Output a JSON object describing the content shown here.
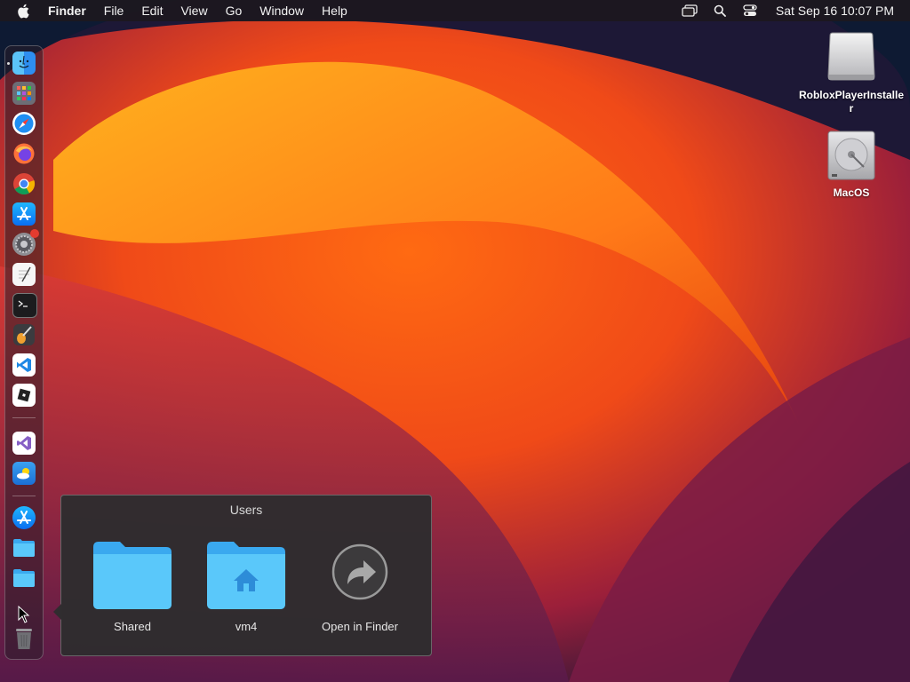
{
  "menubar": {
    "app_name": "Finder",
    "menus": [
      "File",
      "Edit",
      "View",
      "Go",
      "Window",
      "Help"
    ],
    "clock": "Sat Sep 16  10:07 PM"
  },
  "desktop": {
    "icons": [
      {
        "label": "RobloxPlayerInstaller",
        "icon": "disk-image-icon"
      },
      {
        "label": "MacOS",
        "icon": "hard-drive-icon"
      }
    ]
  },
  "dock": {
    "apps": [
      "Finder",
      "Launchpad",
      "Safari",
      "Firefox",
      "Chrome",
      "App Store",
      "System Preferences",
      "TextEdit",
      "Terminal",
      "GarageBand",
      "Visual Studio Code",
      "Roblox",
      "Visual Studio",
      "Weather",
      "App Store",
      "Folder",
      "Folder",
      "Cursor",
      "Trash"
    ]
  },
  "stack": {
    "title": "Users",
    "items": [
      {
        "label": "Shared",
        "icon": "folder-icon"
      },
      {
        "label": "vm4",
        "icon": "home-folder-icon"
      },
      {
        "label": "Open in Finder",
        "icon": "open-in-finder-icon"
      }
    ]
  },
  "colors": {
    "folder": "#5ac8fa",
    "wallpaper_orange": "#ff7a1a",
    "wallpaper_deep": "#1d1836"
  }
}
